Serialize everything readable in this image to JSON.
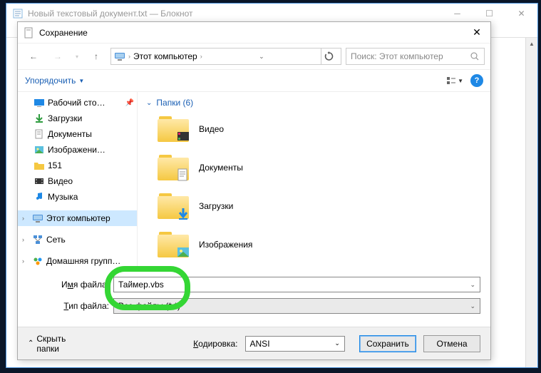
{
  "notepad": {
    "title": "Новый текстовый документ.txt — Блокнот"
  },
  "dialog": {
    "title": "Сохранение",
    "breadcrumb": {
      "root": "Этот компьютер"
    },
    "search_placeholder": "Поиск: Этот компьютер",
    "organize": "Упорядочить",
    "tree": {
      "desktop": "Рабочий сто…",
      "downloads": "Загрузки",
      "documents": "Документы",
      "pictures": "Изображени…",
      "folder151": "151",
      "videos": "Видео",
      "music": "Музыка",
      "this_pc": "Этот компьютер",
      "network": "Сеть",
      "homegroup": "Домашняя групп…"
    },
    "content": {
      "header": "Папки (6)",
      "items": {
        "videos": "Видео",
        "documents": "Документы",
        "downloads": "Загрузки",
        "pictures": "Изображения"
      }
    },
    "fields": {
      "filename_label_pre": "И",
      "filename_label_u": "м",
      "filename_label_post": "я файла:",
      "filetype_label_pre": "",
      "filetype_label_u": "Т",
      "filetype_label_post": "ип файла:",
      "filename_value": "Таймер.vbs",
      "filetype_value": "Все файлы  (*.*)"
    },
    "footer": {
      "hide_folders": "Скрыть папки",
      "encoding_label_pre": "",
      "encoding_label_u": "К",
      "encoding_label_post": "одировка:",
      "encoding_value": "ANSI",
      "save": "Сохранить",
      "cancel": "Отмена"
    }
  }
}
